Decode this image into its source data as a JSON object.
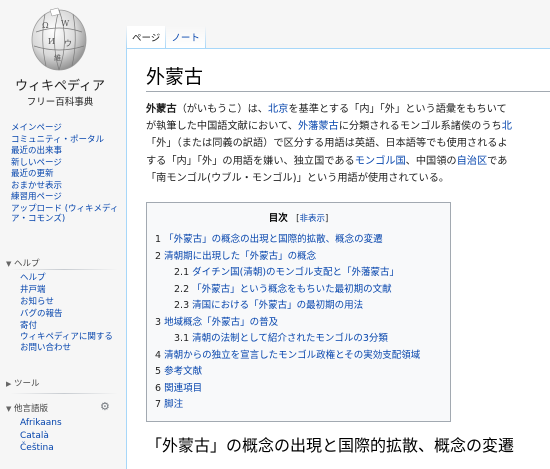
{
  "sidebar": {
    "logo": {
      "wordmark": "ウィキペディア",
      "tagline": "フリー百科事典"
    },
    "nav": [
      "メインページ",
      "コミュニティ・ポータル",
      "最近の出来事",
      "新しいページ",
      "最近の更新",
      "おまかせ表示",
      "練習用ページ",
      "アップロード (ウィキメディア・コモンズ)"
    ],
    "help_header": "ヘルプ",
    "help_items": [
      "ヘルプ",
      "井戸端",
      "お知らせ",
      "バグの報告",
      "寄付",
      "ウィキペディアに関するお問い合わせ"
    ],
    "tools_header": "ツール",
    "lang_header": "他言語版",
    "langs": [
      "Afrikaans",
      "Català",
      "Čeština"
    ]
  },
  "tabs": {
    "page": "ページ",
    "talk": "ノート"
  },
  "article": {
    "title": "外蒙古",
    "lines": [
      [
        {
          "t": "外蒙古",
          "b": true
        },
        {
          "t": "（がいもうこ）は、"
        },
        {
          "t": "北京",
          "a": true
        },
        {
          "t": "を基準とする「内」「外」という語彙をもちいて"
        }
      ],
      [
        {
          "t": "が執筆した中国語文献において、"
        },
        {
          "t": "外藩蒙古",
          "a": true
        },
        {
          "t": "に分類されるモンゴル系諸侯のうち"
        },
        {
          "t": "北",
          "a": true
        }
      ],
      [
        {
          "t": "「外」（または同義の訳語）で区分する用語は英語、日本語等でも使用されるよ"
        }
      ],
      [
        {
          "t": "する「内」「外」の用語を嫌い、独立国である"
        },
        {
          "t": "モンゴル国",
          "a": true
        },
        {
          "t": "、中国領の"
        },
        {
          "t": "自治区",
          "a": true
        },
        {
          "t": "であ"
        }
      ],
      [
        {
          "t": "「南モンゴル(ウブル・モンゴル)」という用語が使用されている。"
        }
      ]
    ],
    "toc": {
      "title": "目次",
      "hide": "非表示",
      "items": [
        {
          "num": "1",
          "text": "「外蒙古」の概念の出現と国際的拡散、概念の変遷",
          "level": 1
        },
        {
          "num": "2",
          "text": "清朝期に出現した「外蒙古」の概念",
          "level": 1
        },
        {
          "num": "2.1",
          "text": "ダイチン国(清朝)のモンゴル支配と「外藩蒙古」",
          "level": 2
        },
        {
          "num": "2.2",
          "text": "「外蒙古」という概念をもちいた最初期の文献",
          "level": 2
        },
        {
          "num": "2.3",
          "text": "清国における「外蒙古」の最初期の用法",
          "level": 2
        },
        {
          "num": "3",
          "text": "地域概念「外蒙古」の普及",
          "level": 1
        },
        {
          "num": "3.1",
          "text": "清朝の法制として紹介されたモンゴルの3分類",
          "level": 2
        },
        {
          "num": "4",
          "text": "清朝からの独立を宣言したモンゴル政権とその実効支配領域",
          "level": 1
        },
        {
          "num": "5",
          "text": "参考文献",
          "level": 1
        },
        {
          "num": "6",
          "text": "関連項目",
          "level": 1
        },
        {
          "num": "7",
          "text": "脚注",
          "level": 1
        }
      ]
    },
    "section_heading": "「外蒙古」の概念の出現と国際的拡散、概念の変遷"
  }
}
